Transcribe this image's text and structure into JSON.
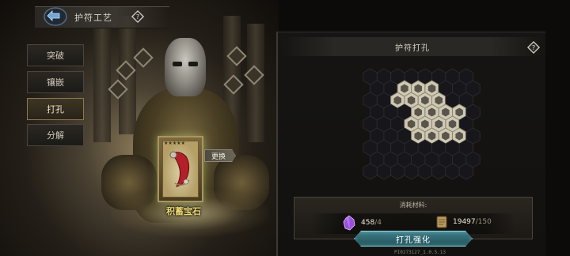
{
  "header": {
    "title": "护符工艺",
    "back_icon": "back-arrow-icon",
    "help_icon": "help-diamond-icon"
  },
  "tabs": [
    {
      "label": "突破",
      "active": false
    },
    {
      "label": "镶嵌",
      "active": false
    },
    {
      "label": "打孔",
      "active": true
    },
    {
      "label": "分解",
      "active": false
    }
  ],
  "item": {
    "name": "积蓄宝石",
    "swap_label": "更换",
    "stars": "★★★★★"
  },
  "panel": {
    "title": "护符打孔",
    "help_icon": "help-diamond-icon",
    "cost_label": "消耗材料:",
    "materials": [
      {
        "icon": "purple-crystal-icon",
        "have": "458",
        "need": "/4"
      },
      {
        "icon": "scroll-icon",
        "have": "19497",
        "need": "/150"
      }
    ],
    "action_label": "打孔强化"
  },
  "version_text": "PI0273127_1.0.5.13",
  "colors": {
    "accent_cyan": "#8fdfe6",
    "gold_name": "#f0d870",
    "crystal_purple": "#9b4fe0"
  }
}
